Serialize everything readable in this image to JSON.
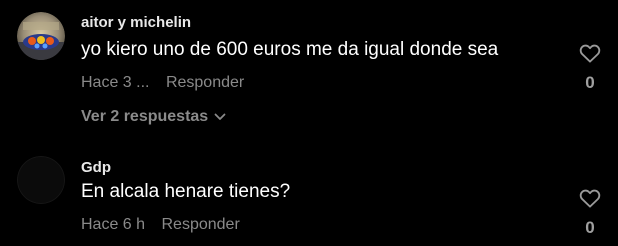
{
  "comments": [
    {
      "username": "aitor y michelin",
      "text": "yo kiero uno de 600 euros me da igual donde sea",
      "time": "Hace 3 ...",
      "reply_label": "Responder",
      "likes": "0",
      "avatar_icon": "round-photo-avatar-icon"
    },
    {
      "username": "Gdp",
      "text": "En alcala henare tienes?",
      "time": "Hace 6 h",
      "reply_label": "Responder",
      "likes": "0",
      "avatar_icon": "dark-avatar-icon"
    }
  ],
  "replies_toggle": {
    "label": "Ver 2 respuestas"
  },
  "colors": {
    "background": "#000000",
    "meta_text": "#8a8a8a",
    "username": "#e8e8e8"
  }
}
